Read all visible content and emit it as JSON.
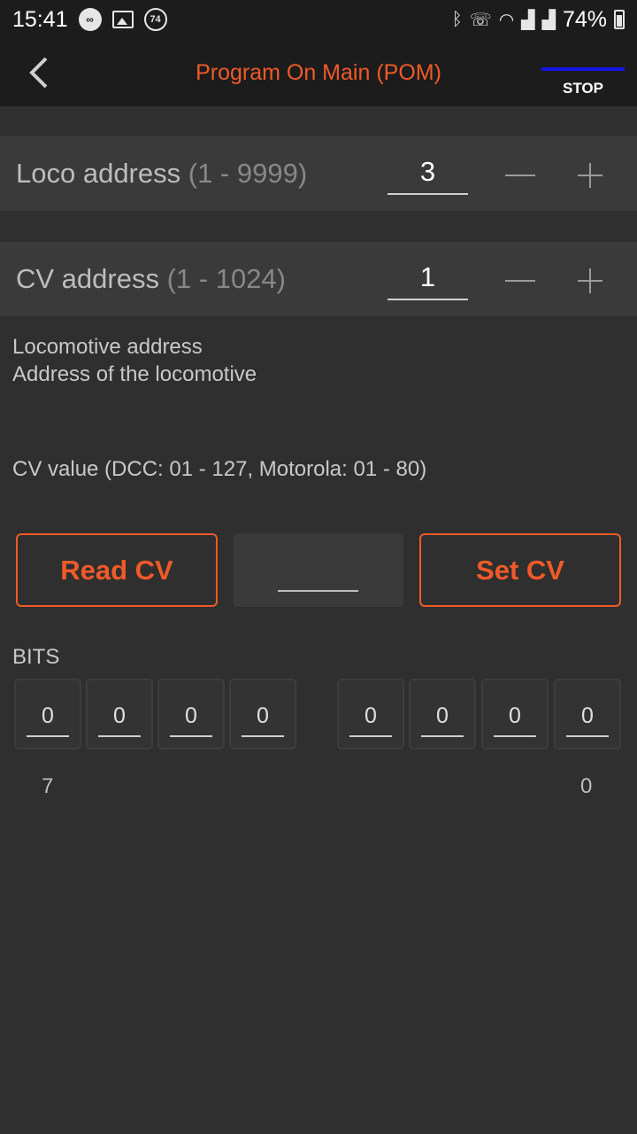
{
  "status_bar": {
    "time": "15:41",
    "notif_badge": "74",
    "battery": "74%",
    "icons": [
      "link-icon",
      "image-icon",
      "badge-icon",
      "bluetooth-icon",
      "wifi-call-icon",
      "wifi-icon",
      "signal-icon",
      "signal-icon",
      "battery-icon"
    ]
  },
  "app_bar": {
    "title": "Program On Main (POM)",
    "stop_label": "STOP",
    "title_color": "#f05a28",
    "stop_indicator_color": "#1414e6"
  },
  "loco": {
    "label": "Loco address",
    "range": "(1 - 9999)",
    "value": "3"
  },
  "cv": {
    "label": "CV address",
    "range": "(1 - 1024)",
    "value": "1"
  },
  "description": {
    "line1": "Locomotive address",
    "line2": "Address of the locomotive"
  },
  "cv_value_label": "CV value (DCC: 01 - 127, Motorola: 01 - 80)",
  "buttons": {
    "read": "Read CV",
    "set": "Set CV"
  },
  "cv_value": "",
  "bits": {
    "title": "BITS",
    "values": [
      "0",
      "0",
      "0",
      "0",
      "0",
      "0",
      "0",
      "0"
    ],
    "high_label": "7",
    "low_label": "0"
  }
}
